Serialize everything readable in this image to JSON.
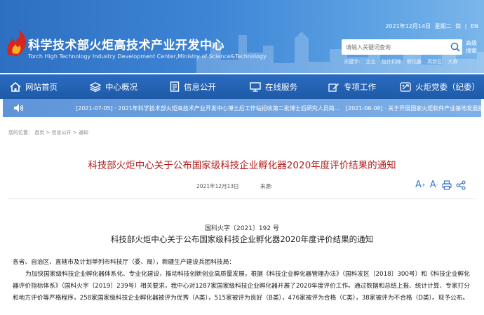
{
  "header": {
    "site_title": "科学技术部火炬高技术产业开发中心",
    "site_subtitle": "Torch High Technology Industry Development Center,Ministry of Science&Technology",
    "date": "2021年12月14日",
    "weekday": "星期二",
    "lang_simplified": "简",
    "lang_divider": "|",
    "lang_en": "EN",
    "search_placeholder": "请输入关键词查询",
    "advanced_search": "高级搜索",
    "keywords_label": "关键字:",
    "keywords": [
      "企业",
      "加计扣除",
      "孵化器",
      "高新区",
      "大赛"
    ],
    "colors": {
      "header_blue": "#2d6fc1",
      "nav_blue": "#1e5aa8",
      "title_red": "#b51d1d",
      "tool_blue": "#3b78c8"
    }
  },
  "nav": {
    "items": [
      {
        "label": "网站首页",
        "icon": "home-icon"
      },
      {
        "label": "中心概况",
        "icon": "layers-icon"
      },
      {
        "label": "信息公开",
        "icon": "document-icon"
      },
      {
        "label": "在线服务",
        "icon": "monitor-icon"
      },
      {
        "label": "专项工作",
        "icon": "edit-icon"
      },
      {
        "label": "火炬党委（纪委）",
        "icon": "party-icon"
      }
    ]
  },
  "notice": {
    "icon": "speaker-icon",
    "items": [
      "[2021-07-05] · 2021年科学技术部火炬高技术产业开发中心博士后工作站招收第二批博士后研究人员简...",
      "[2021-06-08] · 关于开展国家火炬软件产业基地发展报"
    ]
  },
  "breadcrumb": {
    "prefix": "您的位置：",
    "home": "首页",
    "sep1": ">",
    "section": "信息公开",
    "sep2": ">",
    "current": "通知"
  },
  "article": {
    "title": "科技部火炬中心关于公布国家级科技企业孵化器2020年度评价结果的通知",
    "date": "2021年12月13日",
    "source_label": "来源:",
    "tools": {
      "font_larger": "A",
      "font_larger_sign": "+",
      "font_smaller": "A",
      "font_smaller_sign": "-"
    },
    "doc_number": "国科火字〔2021〕192 号",
    "doc_title": "科技部火炬中心关于公布国家级科技企业孵化器2020年度评价结果的通知",
    "salutation": "各省、自治区、直辖市及计划单列市科技厅（委、局），新疆生产建设兵团科技局：",
    "paragraph": "为加快国家级科技企业孵化器体系化、专业化建设，推动科技创新创业高质量发展，根据《科技企业孵化器管理办法》（国科发区〔2018〕300号）和《科技企业孵化器评价指标体系》（国科火字〔2019〕239号）相关要求，我中心对1287家国家级科技企业孵化器开展了2020年度评价工作。通过数据和总结上报、统计计算、专家打分和地方评价等严格程序，258家国家级科技企业孵化器被评为优秀（A类），515家被评为良好（B类），476家被评为合格（C类），38家被评为不合格（D类）。现予公布。"
  }
}
